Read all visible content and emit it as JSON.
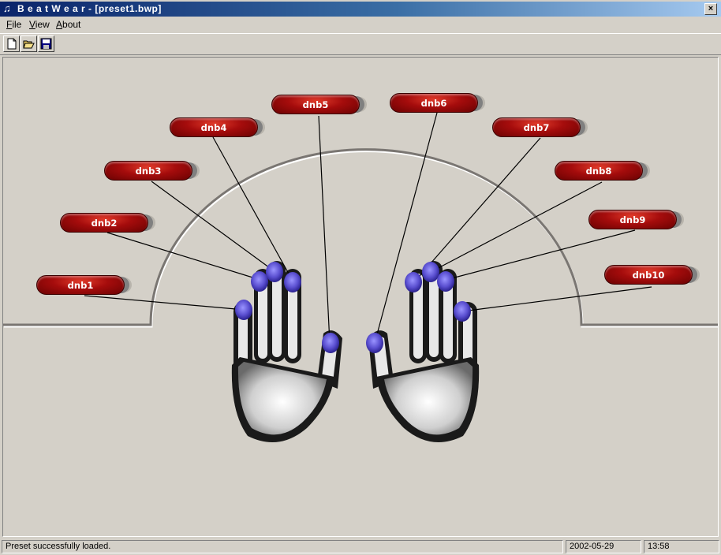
{
  "window": {
    "app_icon": "♫",
    "title": "B e a t W e a r - [preset1.bwp]",
    "close_glyph": "×"
  },
  "menu": {
    "file": {
      "accel": "F",
      "rest": "ile"
    },
    "view": {
      "accel": "V",
      "rest": "iew"
    },
    "about": {
      "accel": "A",
      "rest": "bout"
    }
  },
  "toolbar": {
    "icons": [
      "new-document-icon",
      "open-folder-icon",
      "save-disk-icon"
    ]
  },
  "pads": [
    {
      "id": "dnb1",
      "label": "dnb1"
    },
    {
      "id": "dnb2",
      "label": "dnb2"
    },
    {
      "id": "dnb3",
      "label": "dnb3"
    },
    {
      "id": "dnb4",
      "label": "dnb4"
    },
    {
      "id": "dnb5",
      "label": "dnb5"
    },
    {
      "id": "dnb6",
      "label": "dnb6"
    },
    {
      "id": "dnb7",
      "label": "dnb7"
    },
    {
      "id": "dnb8",
      "label": "dnb8"
    },
    {
      "id": "dnb9",
      "label": "dnb9"
    },
    {
      "id": "dnb10",
      "label": "dnb10"
    }
  ],
  "colors": {
    "pad_red": "#a50c0c",
    "finger_marker": "#5a4fd0",
    "titlebar_start": "#0a246a",
    "titlebar_end": "#a6caf0"
  },
  "status": {
    "message": "Preset successfully loaded.",
    "date": "2002-05-29",
    "time": "13:58"
  }
}
